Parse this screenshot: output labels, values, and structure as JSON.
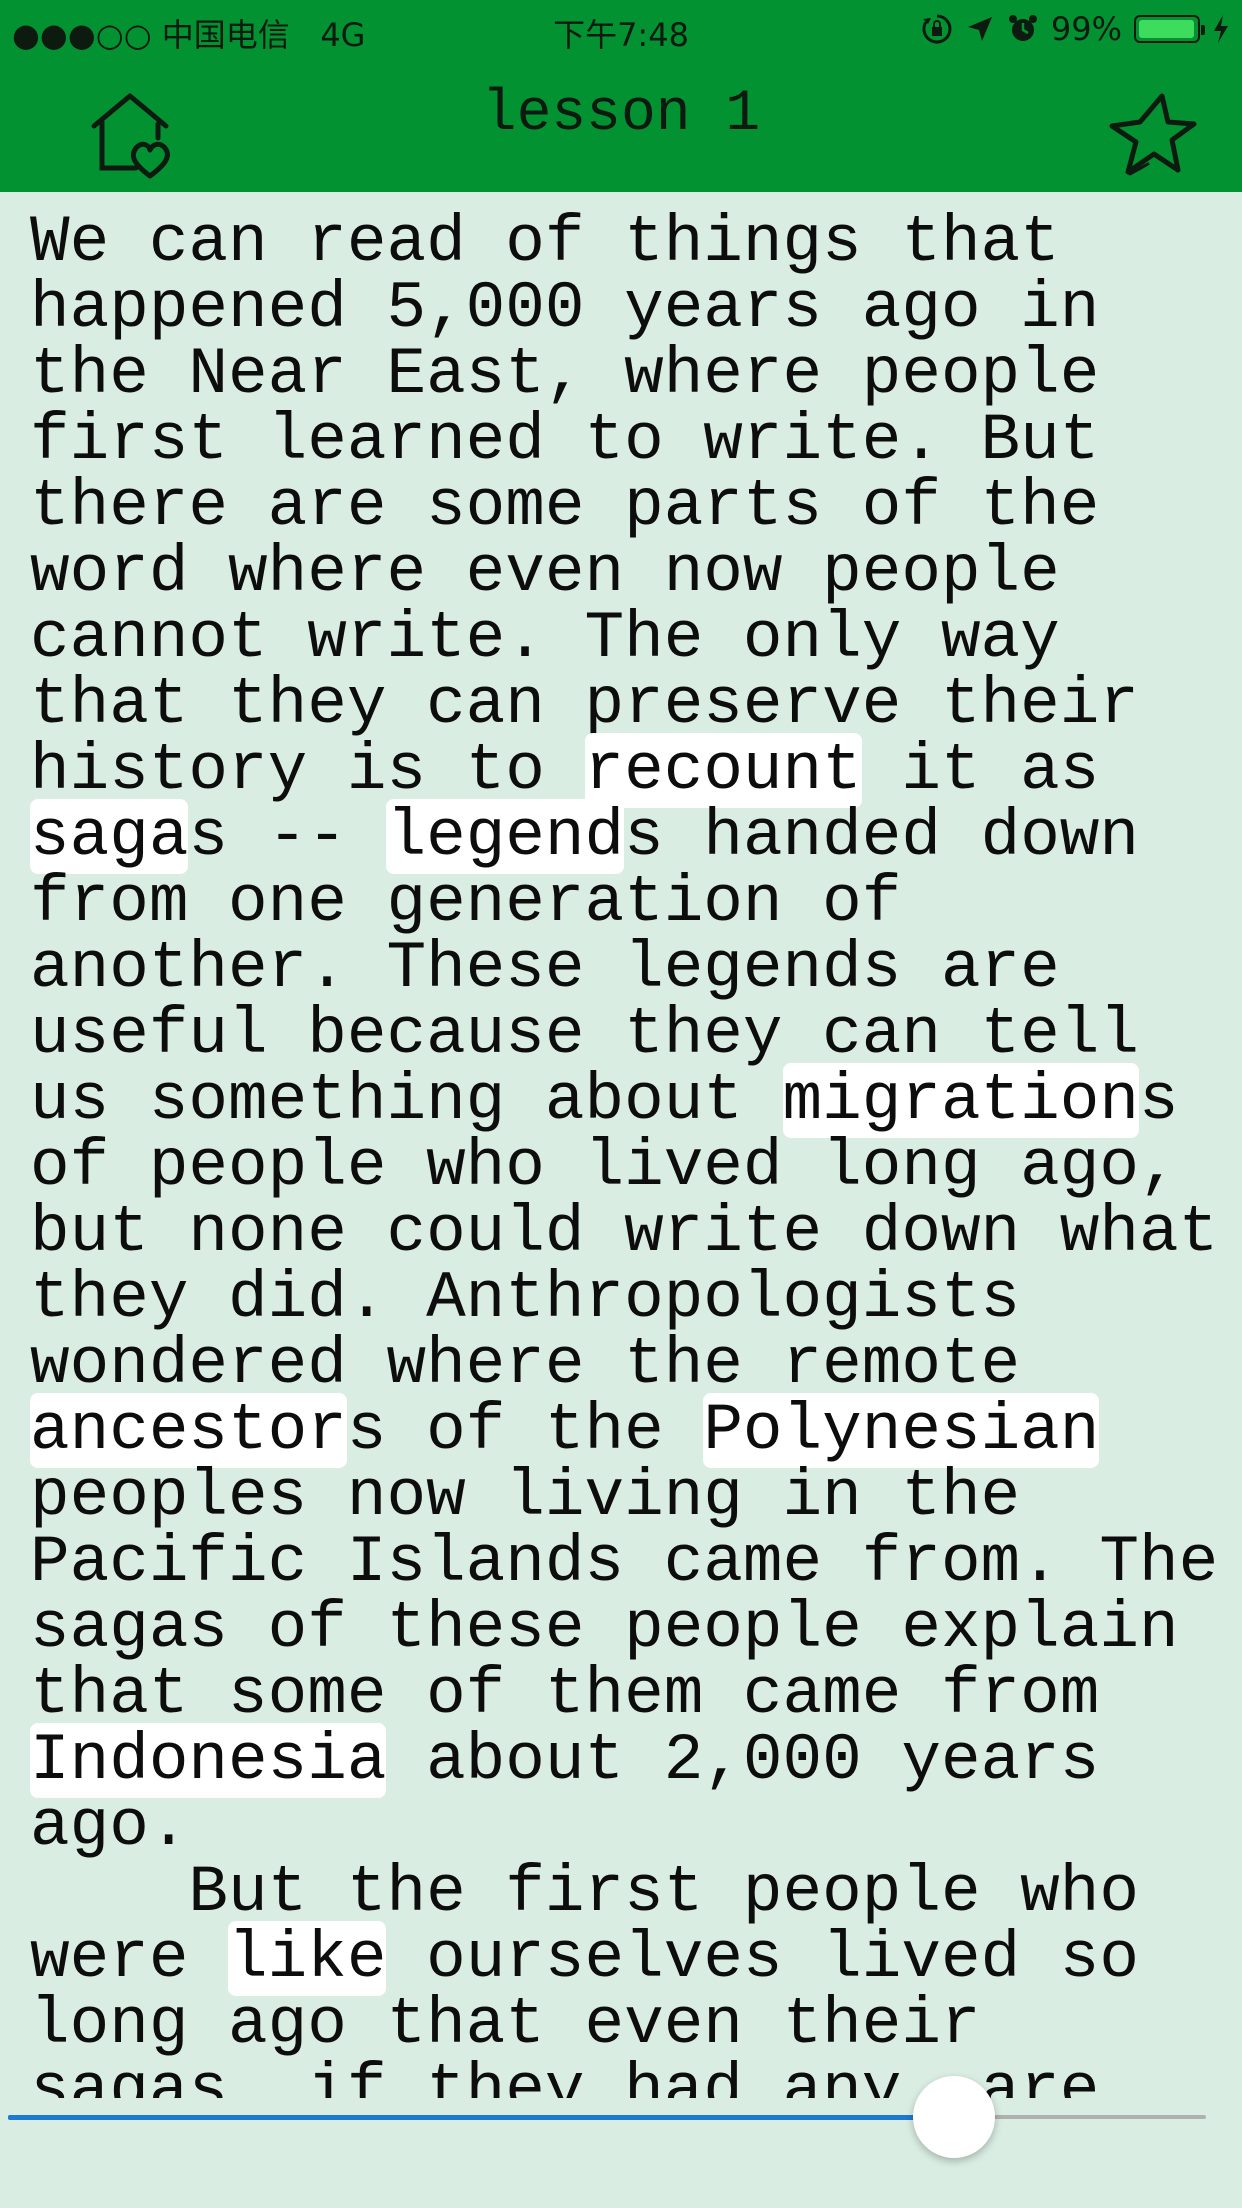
{
  "status_bar": {
    "signal": "●●●○○",
    "carrier": "中国电信",
    "network": "4G",
    "time": "下午7:48",
    "battery_percent": "99%",
    "battery_level": 0.99
  },
  "nav": {
    "title": "lesson 1",
    "home_icon": "house-heart-icon",
    "favorite_icon": "star-icon"
  },
  "reader": {
    "lines": [
      [
        {
          "t": "We can read of things that"
        }
      ],
      [
        {
          "t": "happened 5,000 years ago in"
        }
      ],
      [
        {
          "t": "the Near East, where people"
        }
      ],
      [
        {
          "t": "first learned to write. But"
        }
      ],
      [
        {
          "t": "there are some parts of the"
        }
      ],
      [
        {
          "t": "word where even now people"
        }
      ],
      [
        {
          "t": "cannot write. The only way"
        }
      ],
      [
        {
          "t": "that they can preserve their"
        }
      ],
      [
        {
          "t": "history is to "
        },
        {
          "t": "recount",
          "h": true
        },
        {
          "t": " it as"
        }
      ],
      [
        {
          "t": "saga",
          "h": true
        },
        {
          "t": "s -- "
        },
        {
          "t": "legend",
          "h": true
        },
        {
          "t": "s handed down"
        }
      ],
      [
        {
          "t": "from one generation of"
        }
      ],
      [
        {
          "t": "another. These legends are"
        }
      ],
      [
        {
          "t": "useful because they can tell"
        }
      ],
      [
        {
          "t": "us something about "
        },
        {
          "t": "migration",
          "h": true
        },
        {
          "t": "s"
        }
      ],
      [
        {
          "t": "of people who lived long ago,"
        }
      ],
      [
        {
          "t": "but none could write down what"
        }
      ],
      [
        {
          "t": "they did. Anthropologists"
        }
      ],
      [
        {
          "t": "wondered where the remote"
        }
      ],
      [
        {
          "t": "ancestor",
          "h": true
        },
        {
          "t": "s of the "
        },
        {
          "t": "Polynesian",
          "h": true
        }
      ],
      [
        {
          "t": "peoples now living in the"
        }
      ],
      [
        {
          "t": "Pacific Islands came from. The"
        }
      ],
      [
        {
          "t": "sagas of these people explain"
        }
      ],
      [
        {
          "t": "that some of them came from"
        }
      ],
      [
        {
          "t": "Indonesia",
          "h": true
        },
        {
          "t": " about 2,000 years"
        }
      ],
      [
        {
          "t": "ago."
        }
      ],
      [
        {
          "t": "    But the first people who"
        }
      ],
      [
        {
          "t": "were "
        },
        {
          "t": "like",
          "h": true
        },
        {
          "t": " ourselves lived so"
        }
      ],
      [
        {
          "t": "long ago that even their"
        }
      ],
      [
        {
          "t": "sagas, if they had any, are"
        }
      ]
    ]
  },
  "progress": {
    "value": 0.79
  },
  "colors": {
    "bar": "#039232",
    "page_bg": "#d9ede2",
    "highlight": "#ffffff",
    "slider_fill": "#1f78d1"
  }
}
